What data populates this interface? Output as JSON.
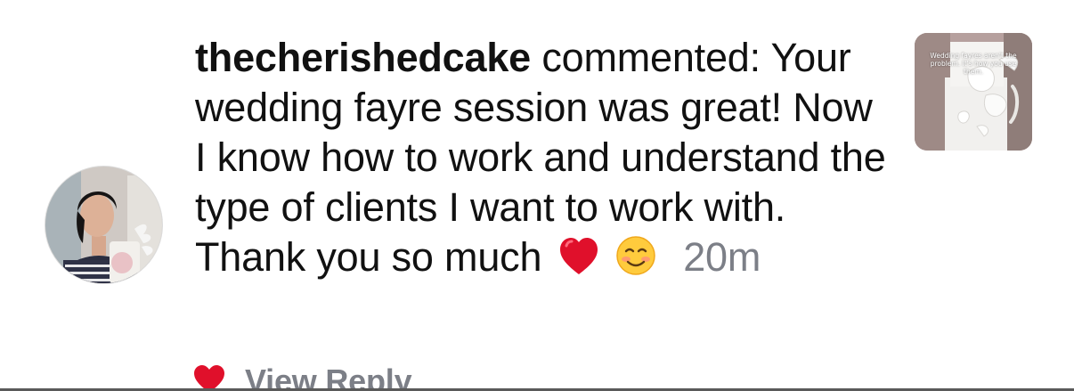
{
  "notification": {
    "username": "thecherishedcake",
    "action": "commented:",
    "comment": "Your wedding fayre session was great! Now I know how to work and understand the type of clients I want to work with. Thank you so much",
    "emojis": [
      "red-heart-emoji",
      "smiling-face-emoji"
    ],
    "time": "20m",
    "thumbnail_caption": "Wedding fayres aren't the problem. It's how you use them."
  },
  "reply": {
    "label": "View Reply",
    "heart_icon": "heart-icon"
  },
  "colors": {
    "text": "#111111",
    "muted": "#7c7f87",
    "heart": "#e0102b",
    "background": "#ffffff"
  }
}
